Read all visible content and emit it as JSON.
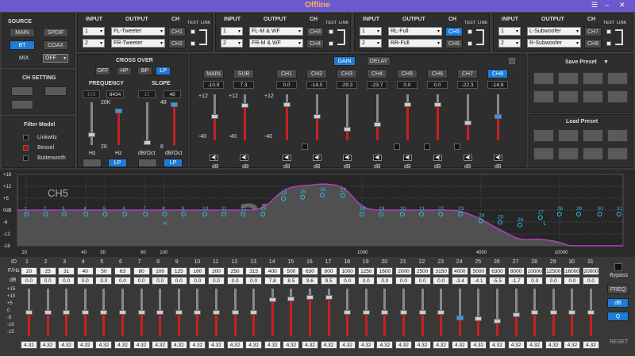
{
  "title": "Offline",
  "win": {
    "menu": "☰",
    "min": "–",
    "close": "✕"
  },
  "source": {
    "label": "SOURCE",
    "main": "MAIN",
    "spdif": "SPDIF",
    "bt": "BT",
    "coax": "COAX",
    "mix": "MIX",
    "mix_val": "OFF"
  },
  "routing": [
    {
      "input": "INPUT",
      "output": "OUTPUT",
      "ch": "CH",
      "test": "TEST",
      "link": "LINK",
      "rows": [
        {
          "in": "1",
          "out": "FL-Tweeter",
          "ch": "CH1"
        },
        {
          "in": "2",
          "out": "FR-Tweeter",
          "ch": "CH2"
        }
      ]
    },
    {
      "input": "INPUT",
      "output": "OUTPUT",
      "ch": "CH",
      "test": "TEST",
      "link": "LINK",
      "rows": [
        {
          "in": "1",
          "out": "FL-M & WF",
          "ch": "CH3"
        },
        {
          "in": "2",
          "out": "FR-M & WF",
          "ch": "CH4"
        }
      ]
    },
    {
      "input": "INPUT",
      "output": "OUTPUT",
      "ch": "CH",
      "test": "TEST",
      "link": "LINK",
      "rows": [
        {
          "in": "1",
          "out": "RL-Full",
          "ch": "CH5"
        },
        {
          "in": "2",
          "out": "RR-Full",
          "ch": "CH6"
        }
      ]
    },
    {
      "input": "INPUT",
      "output": "OUTPUT",
      "ch": "CH",
      "test": "TEST",
      "link": "LINK",
      "rows": [
        {
          "in": "1",
          "out": "L-Subwoofer",
          "ch": "CH7"
        },
        {
          "in": "2",
          "out": "R-Subwoofer",
          "ch": "CH8"
        }
      ]
    }
  ],
  "ch_setting": {
    "label": "CH SETTING"
  },
  "filter_model": {
    "label": "Filter Model",
    "items": [
      "Linkwitz",
      "Bessel",
      "Butterworth"
    ]
  },
  "crossover": {
    "label": "CROSS OVER",
    "off": "OFF",
    "hp": "HP",
    "bp": "BP",
    "lp": "LP",
    "freq": "FREQUENCY",
    "slope": "SLOPE",
    "f1": "103",
    "f2": "8434",
    "s1": "12",
    "s2": "48",
    "k20": "20K",
    "k20b": "20",
    "s48": "48",
    "s6": "6",
    "hz": "Hz",
    "hz2": "Hz",
    "dbo": "dB/Oct",
    "dbo2": "dB/Oct",
    "lp1": "LP",
    "lp2": "LP"
  },
  "gain": {
    "gain": "GAIN",
    "delay": "DELAY",
    "main": "MAIN",
    "sub": "SUB",
    "main_v": "-10.9",
    "sub_v": "7.3",
    "p12a": "+12",
    "p12b": "+12",
    "p12c": "+12",
    "m40a": "-40",
    "m40b": "-40",
    "m40c": "-40",
    "p12d": "12",
    "db": "dB",
    "chs": [
      {
        "n": "CH1",
        "v": "0.0"
      },
      {
        "n": "CH2",
        "v": "-14.0"
      },
      {
        "n": "CH3",
        "v": "-29.3"
      },
      {
        "n": "CH4",
        "v": "-23.7"
      },
      {
        "n": "CH5",
        "v": "0.0"
      },
      {
        "n": "CH6",
        "v": "0.0"
      },
      {
        "n": "CH7",
        "v": "-22.3"
      },
      {
        "n": "CH8",
        "v": "-14.9"
      }
    ]
  },
  "preset": {
    "save": "Save Preset",
    "load": "Load Preset"
  },
  "graph": {
    "ch": "CH5",
    "logo": "awavo",
    "y": [
      "+18",
      "+12",
      "+6",
      "0dB",
      "-6",
      "-12",
      "-18"
    ],
    "x": [
      "20",
      "40",
      "50",
      "80",
      "100",
      "1000",
      "4000",
      "10000"
    ],
    "h": "H",
    "l": "L"
  },
  "eq": {
    "id": "ID",
    "fhz": "F/Hz",
    "db": "dB",
    "q": "4.32",
    "bypass": "Bypass",
    "freq": "FREQ",
    "dbb": "dB",
    "qb": "Q",
    "reset": "RESET",
    "yl": [
      "+15",
      "+10",
      "+5",
      "0",
      "-5",
      "-10",
      "-15"
    ],
    "f": [
      "20",
      "25",
      "31",
      "40",
      "50",
      "63",
      "80",
      "100",
      "125",
      "160",
      "200",
      "250",
      "315",
      "400",
      "500",
      "630",
      "800",
      "1000",
      "1250",
      "1600",
      "2000",
      "2500",
      "3150",
      "4000",
      "5000",
      "6300",
      "8000",
      "10000",
      "12500",
      "16000",
      "20000"
    ],
    "g": [
      "0.0",
      "0.0",
      "0.0",
      "0.0",
      "0.0",
      "0.0",
      "0.0",
      "0.0",
      "0.0",
      "0.0",
      "0.0",
      "0.0",
      "0.0",
      "7.8",
      "8.5",
      "9.6",
      "9.5",
      "0.0",
      "0.0",
      "0.0",
      "0.0",
      "0.0",
      "0.0",
      "-3.4",
      "-4.1",
      "-5.5",
      "-1.7",
      "0.0",
      "0.0",
      "0.0",
      "0.0"
    ]
  },
  "chart_data": {
    "type": "line",
    "title": "CH5",
    "x": [
      20,
      25,
      31,
      40,
      50,
      63,
      80,
      100,
      125,
      160,
      200,
      250,
      315,
      400,
      500,
      630,
      800,
      1000,
      1250,
      1600,
      2000,
      2500,
      3150,
      4000,
      5000,
      6300,
      8000,
      10000,
      12500,
      16000,
      20000
    ],
    "values": [
      0,
      0,
      0,
      0,
      0,
      0,
      0,
      0,
      0,
      0,
      0,
      0,
      0,
      7.8,
      8.5,
      9.6,
      9.5,
      0,
      0,
      0,
      0,
      0,
      0,
      -3.4,
      -4.1,
      -5.5,
      -1.7,
      0,
      0,
      0,
      0
    ],
    "ylim": [
      -18,
      18
    ],
    "xlabel": "",
    "ylabel": ""
  }
}
